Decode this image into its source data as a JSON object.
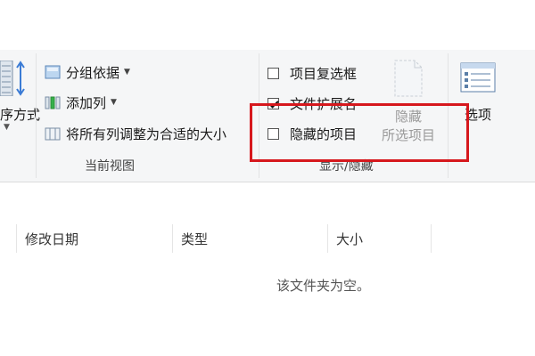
{
  "ribbon": {
    "layout_group": {
      "sort_label": "序方式"
    },
    "current_view": {
      "group_by_label": "分组依据",
      "add_column_label": "添加列",
      "size_all_columns_label": "将所有列调整为合适的大小",
      "group_label": "当前视图"
    },
    "show_hide": {
      "item_checkboxes_label": "项目复选框",
      "item_checkboxes_checked": false,
      "file_extensions_label": "文件扩展名",
      "file_extensions_checked": true,
      "hidden_items_label": "隐藏的项目",
      "hidden_items_checked": false,
      "hide_selected_line1": "隐藏",
      "hide_selected_line2": "所选项目",
      "group_label": "显示/隐藏"
    },
    "options_label": "选项"
  },
  "file_list": {
    "columns": [
      "修改日期",
      "类型",
      "大小"
    ],
    "empty_message": "该文件夹为空。"
  },
  "colors": {
    "highlight": "#d6181d",
    "ribbon_bg": "#f5f6f7",
    "disabled_text": "#9a9a9a"
  }
}
